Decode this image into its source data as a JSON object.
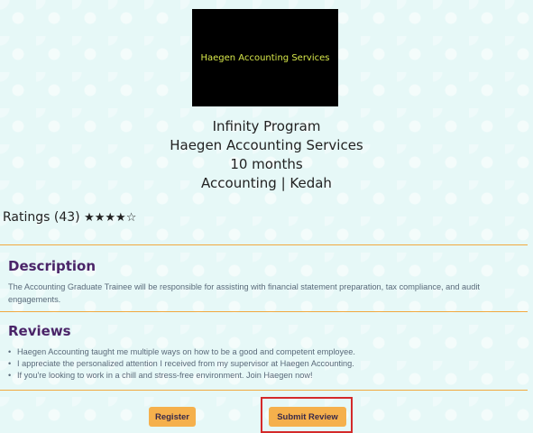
{
  "logo": {
    "text": "Haegen Accounting Services"
  },
  "program": {
    "name": "Infinity Program",
    "company": "Haegen Accounting Services",
    "duration": "10 months",
    "category_location": "Accounting | Kedah"
  },
  "ratings": {
    "label": "Ratings (43)",
    "stars_text": "★★★★☆",
    "score": 4,
    "max": 5
  },
  "description": {
    "title": "Description",
    "text": "The Accounting Graduate Trainee will be responsible for assisting with financial statement preparation, tax compliance, and audit engagements."
  },
  "reviews": {
    "title": "Reviews",
    "items": [
      "Haegen Accounting taught me multiple ways on how to be a good and competent employee.",
      "I appreciate the personalized attention I received from my supervisor at Haegen Accounting.",
      "If you're looking to work in a chill and stress-free environment. Join Haegen now!"
    ]
  },
  "actions": {
    "register_label": "Register",
    "submit_review_label": "Submit Review"
  },
  "colors": {
    "accent": "#f5b04c",
    "heading": "#4a2468",
    "divider": "#f1a93f",
    "highlight": "#d42a2a"
  }
}
